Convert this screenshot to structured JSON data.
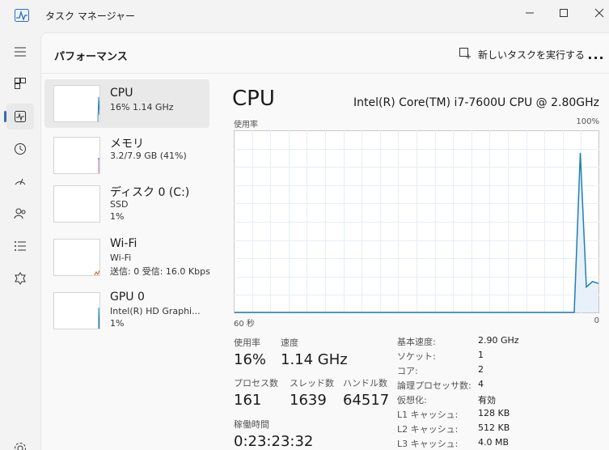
{
  "window": {
    "title": "タスク マネージャー"
  },
  "header": {
    "page_title": "パフォーマンス",
    "new_task_label": "新しいタスクを実行する",
    "more_label": "..."
  },
  "nav": {
    "items": [
      {
        "name": "hamburger-icon"
      },
      {
        "name": "processes-icon"
      },
      {
        "name": "performance-icon",
        "active": true
      },
      {
        "name": "app-history-icon"
      },
      {
        "name": "startup-icon"
      },
      {
        "name": "users-icon"
      },
      {
        "name": "details-icon"
      },
      {
        "name": "services-icon"
      },
      {
        "name": "settings-icon"
      }
    ]
  },
  "devices": [
    {
      "name": "CPU",
      "line1": "16%  1.14 GHz",
      "line2": "",
      "color": "#1f7fb4",
      "selected": true
    },
    {
      "name": "メモリ",
      "line1": "3.2/7.9 GB (41%)",
      "line2": "",
      "color": "#8e44ad"
    },
    {
      "name": "ディスク 0 (C:)",
      "line1": "SSD",
      "line2": "1%",
      "color": "#4c9a2a"
    },
    {
      "name": "Wi-Fi",
      "line1": "Wi-Fi",
      "line2": "送信: 0  受信: 16.0 Kbps",
      "color": "#b5651d"
    },
    {
      "name": "GPU 0",
      "line1": "Intel(R) HD Graphi...",
      "line2": "1%",
      "color": "#1f7fb4"
    }
  ],
  "detail": {
    "title": "CPU",
    "model": "Intel(R) Core(TM) i7-7600U CPU @ 2.80GHz",
    "graph_label_left": "使用率",
    "graph_label_right": "100%",
    "axis_left": "60 秒",
    "axis_right": "0"
  },
  "chart_data": {
    "type": "area",
    "ylabel": "使用率",
    "ylim": [
      0,
      100
    ],
    "x_label_left": "60 秒",
    "x_label_right": "0",
    "x": [
      0,
      1,
      2,
      3,
      4,
      5,
      6,
      7,
      8,
      9,
      10,
      11,
      12,
      13,
      14,
      15,
      16,
      17,
      18,
      19,
      20,
      21,
      22,
      23,
      24,
      25,
      26,
      27,
      28,
      29,
      30,
      31,
      32,
      33,
      34,
      35,
      36,
      37,
      38,
      39,
      40,
      41,
      42,
      43,
      44,
      45,
      46,
      47,
      48,
      49,
      50,
      51,
      52,
      53,
      54,
      55,
      56,
      57,
      58,
      59,
      60
    ],
    "values": [
      0,
      0,
      0,
      0,
      0,
      0,
      0,
      0,
      0,
      0,
      0,
      0,
      0,
      0,
      0,
      0,
      0,
      0,
      0,
      0,
      0,
      0,
      0,
      0,
      0,
      0,
      0,
      0,
      0,
      0,
      0,
      0,
      0,
      0,
      0,
      0,
      0,
      0,
      0,
      0,
      0,
      0,
      0,
      0,
      0,
      0,
      0,
      0,
      0,
      0,
      0,
      0,
      0,
      0,
      0,
      0,
      0,
      88,
      14,
      17,
      16
    ],
    "color": "#1f7fb4"
  },
  "stats": {
    "usage_label": "使用率",
    "usage_value": "16%",
    "speed_label": "速度",
    "speed_value": "1.14 GHz",
    "processes_label": "プロセス数",
    "processes_value": "161",
    "threads_label": "スレッド数",
    "threads_value": "1639",
    "handles_label": "ハンドル数",
    "handles_value": "64517",
    "uptime_label": "稼働時間",
    "uptime_value": "0:23:23:32"
  },
  "specs": [
    {
      "key": "基本速度:",
      "value": "2.90 GHz"
    },
    {
      "key": "ソケット:",
      "value": "1"
    },
    {
      "key": "コア:",
      "value": "2"
    },
    {
      "key": "論理プロセッサ数:",
      "value": "4"
    },
    {
      "key": "仮想化:",
      "value": "有効"
    },
    {
      "key": "L1 キャッシュ:",
      "value": "128 KB"
    },
    {
      "key": "L2 キャッシュ:",
      "value": "512 KB"
    },
    {
      "key": "L3 キャッシュ:",
      "value": "4.0 MB"
    }
  ]
}
